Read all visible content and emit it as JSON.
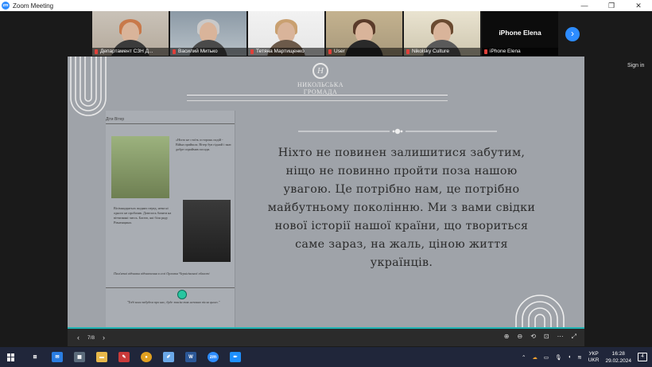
{
  "window": {
    "title": "Zoom Meeting",
    "controls": [
      "—",
      "❐",
      "✕"
    ]
  },
  "participants": [
    {
      "name": "Департамент СЗН Д...",
      "hair": "#c8794a",
      "shirt": "#3b3b3b"
    },
    {
      "name": "Василий Митько",
      "hair": "#c9c9c9",
      "shirt": "#4a4a4a"
    },
    {
      "name": "Тетяна Мартищенко",
      "hair": "#c9a070",
      "shirt": "#6c5a4a"
    },
    {
      "name": "User",
      "hair": "#5a3b2a",
      "shirt": "#2a2a2a"
    },
    {
      "name": "Nikolsky Culture",
      "hair": "#6a4a30",
      "shirt": "#5a5a5a"
    },
    {
      "name": "iPhone Elena",
      "big": "iPhone Elena"
    }
  ],
  "next_arrow": "›",
  "sign_in": "Sign in",
  "slide": {
    "logo_letter": "Н",
    "logo_text": "НИКОЛЬСЬКА ГРОМАДА",
    "quote": "Ніхто не повинен залишитися забутим, ніщо не повинно пройти поза нашою увагою. Це потрібно нам, це потрібно майбутньому поколінню. Ми з вами свідки нової історії нашої країни, що твориться саме зараз, на жаль, ціною життя українців.",
    "doc_header": "Діти Вітер",
    "doc_col1": "Вісімнадцятьох жодних перед, нема ні одного не пробачив. Довелось бачити на вітчизняні чиєсь. Багато, які біля ряду Рівненщини.",
    "doc_col2": "«Ніхто не стоїть осторонь подій - Війна прийшла. Вітер був гідний і знає добре сприймав посади.",
    "doc_caption": "Пам'ятні відзнаки відзначення в селі Орловка Чернігівської області",
    "doc_quote": "\"Тоді коли забудем про нас, буде зовсім так неповно після цього.\""
  },
  "control_bar": {
    "prev": "‹",
    "page": "7/8",
    "next": "›",
    "tools": [
      "⊕",
      "⊖",
      "⟲",
      "⊡",
      "⋯",
      "⤢"
    ]
  },
  "taskbar": {
    "apps": [
      {
        "name": "task-view-icon",
        "label": "⊞",
        "color": "#20263a"
      },
      {
        "name": "mail-icon",
        "label": "✉",
        "color": "#2a7de1"
      },
      {
        "name": "calculator-icon",
        "label": "▦",
        "color": "#5b6b7b"
      },
      {
        "name": "folder-icon",
        "label": "▬",
        "color": "#e8b84a"
      },
      {
        "name": "paint-icon",
        "label": "✎",
        "color": "#c93a3a"
      },
      {
        "name": "chrome-icon",
        "label": "●",
        "color": "#e0a020"
      },
      {
        "name": "notepad-icon",
        "label": "✐",
        "color": "#6aa8e8"
      },
      {
        "name": "word-icon",
        "label": "W",
        "color": "#2b5797"
      },
      {
        "name": "zoom-icon",
        "label": "zm",
        "color": "#2d8cff"
      },
      {
        "name": "pen-icon",
        "label": "✏",
        "color": "#1e90ff"
      }
    ],
    "lang": [
      "УКР",
      "UKR"
    ],
    "time": "16:28",
    "date": "29.02.2024",
    "notifications": "4"
  }
}
